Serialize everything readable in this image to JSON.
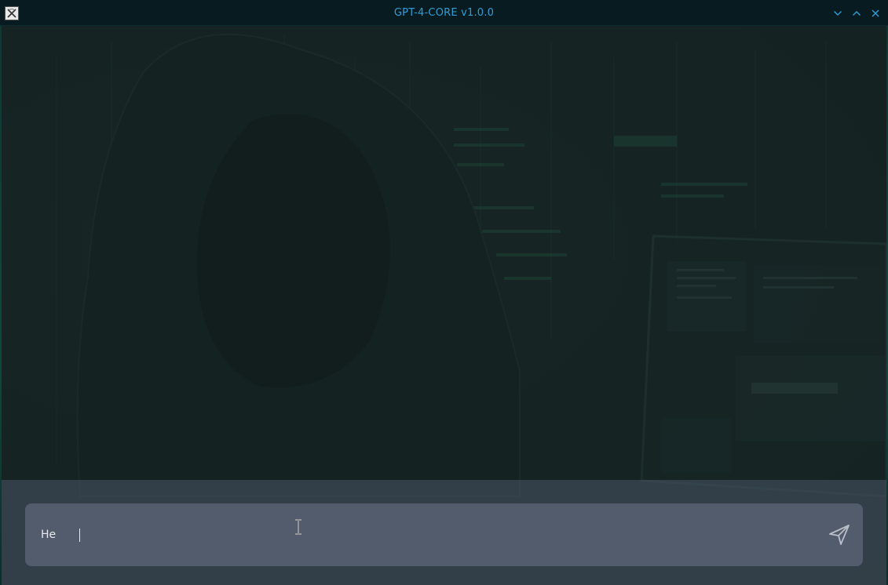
{
  "window": {
    "title": "GPT-4-CORE v1.0.0",
    "icons": {
      "app": "app-icon",
      "minimize": "chevron-down-icon",
      "maximize": "chevron-up-icon",
      "close": "close-icon"
    },
    "colors": {
      "title": "#2e9fd8",
      "titlebar_bg": "#071b20",
      "controls": "#2e9fd8"
    }
  },
  "composer": {
    "value": "He",
    "send_icon": "send-icon",
    "colors": {
      "panel_bg": "#4a5260",
      "box_bg": "#606878",
      "text": "#e6e9ee",
      "send_icon": "#b9bec8"
    }
  }
}
